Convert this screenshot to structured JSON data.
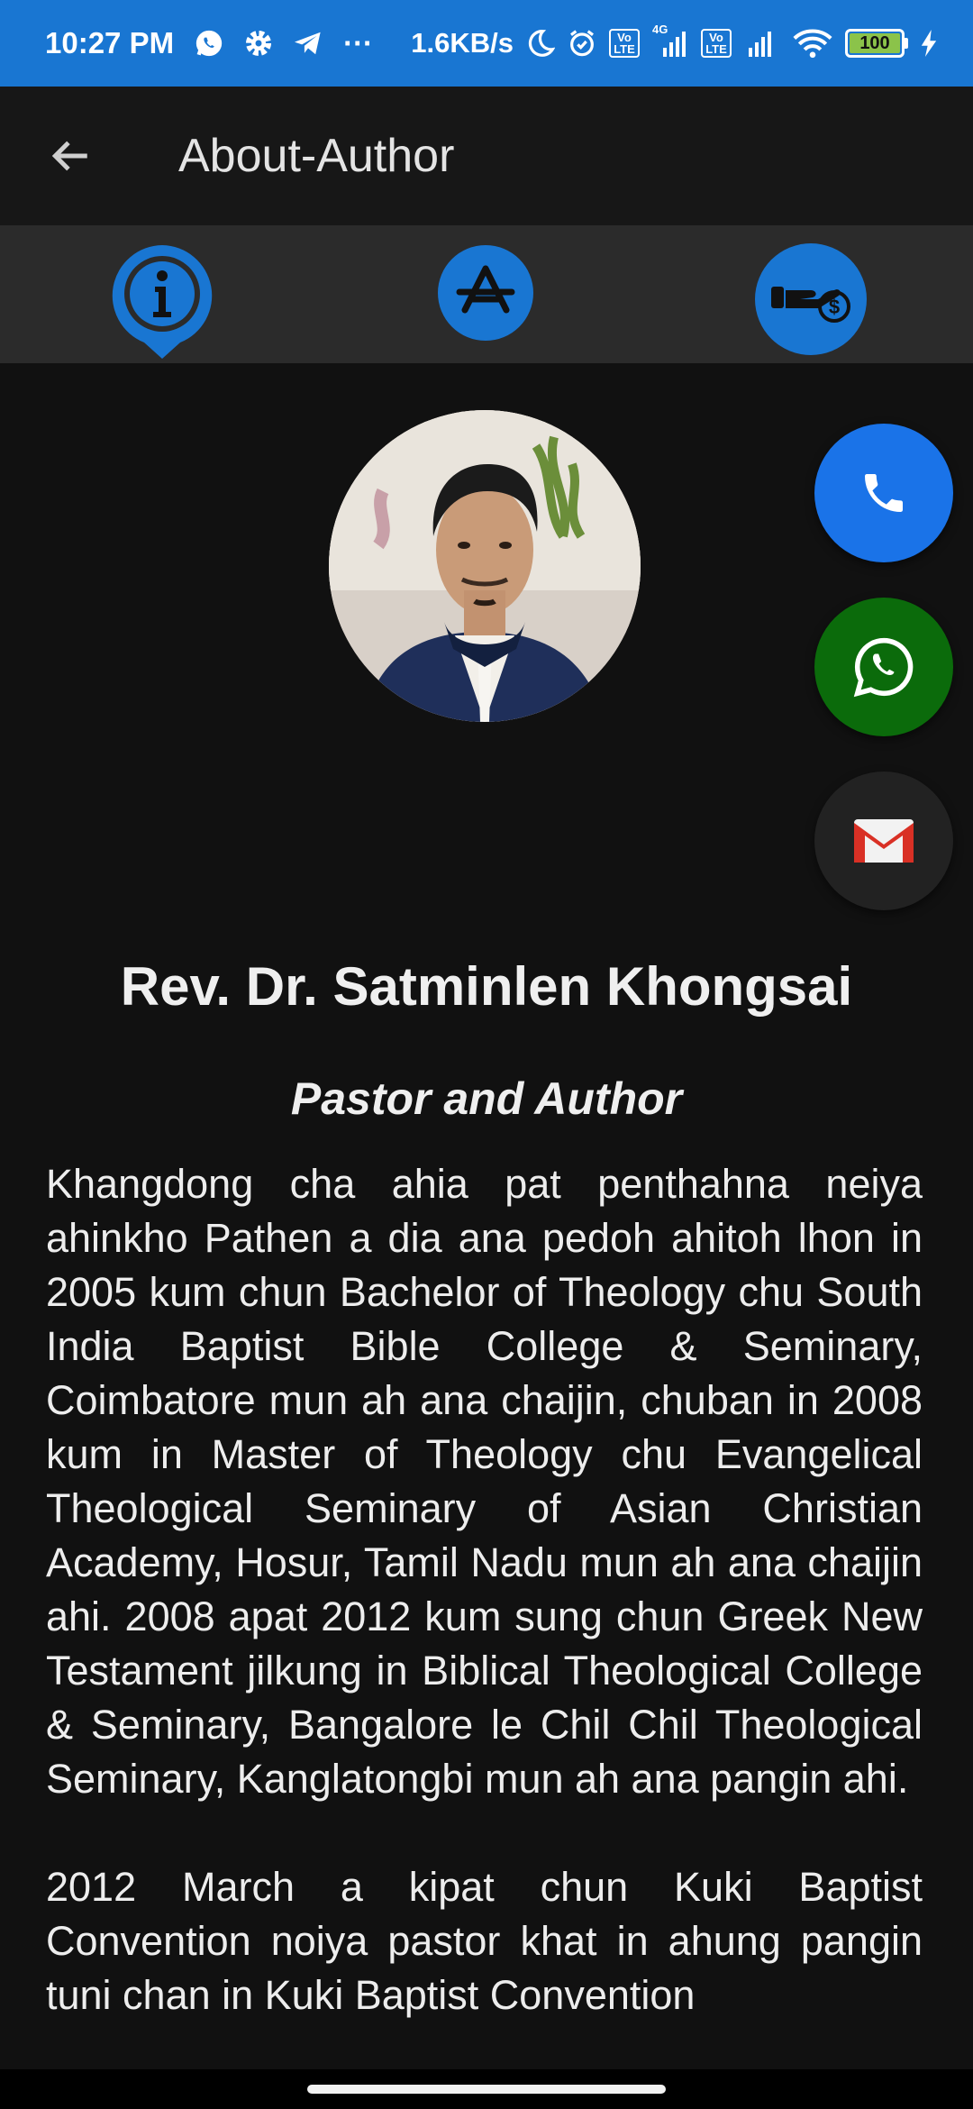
{
  "status_bar": {
    "time": "10:27 PM",
    "more": "···",
    "speed": "1.6KB/s",
    "net_badge_1": "Vo LTE",
    "net_badge_4g": "4G",
    "net_badge_2": "Vo LTE",
    "battery": "100",
    "icons": [
      "whatsapp-icon",
      "settings-icon",
      "telegram-icon",
      "moon-icon",
      "alarm-icon",
      "signal-icon",
      "wifi-icon",
      "battery-icon",
      "charging-icon"
    ]
  },
  "app_bar": {
    "title": "About-Author",
    "back_icon": "arrow-back-icon"
  },
  "tabs": [
    {
      "icon": "info-icon"
    },
    {
      "icon": "app-store-icon"
    },
    {
      "icon": "donate-icon"
    }
  ],
  "fabs": [
    {
      "icon": "phone-icon",
      "color": "#1a73e8"
    },
    {
      "icon": "whatsapp-icon",
      "color": "#0b6b0b"
    },
    {
      "icon": "gmail-icon",
      "color": "#222222"
    }
  ],
  "profile": {
    "name": "Rev. Dr. Satminlen Khongsai",
    "role": "Pastor and Author"
  },
  "bio": [
    "Khangdong cha ahia pat penthahna neiya ahinkho Pathen a dia ana pedoh ahitoh lhon in 2005 kum chun Bachelor of Theology chu South India Baptist Bible College & Seminary, Coimbatore mun ah ana chaijin, chuban in 2008 kum in  Master of Theology chu Evangelical Theological Seminary of Asian Christian Academy, Hosur, Tamil Nadu mun ah ana chaijin ahi. 2008 apat 2012 kum sung chun Greek New Testament jilkung in Biblical Theological College & Seminary, Bangalore le Chil Chil Theological Seminary, Kanglatongbi mun ah ana pangin ahi.",
    "2012 March a kipat chun Kuki Baptist Convention noiya pastor khat in ahung pangin tuni chan in Kuki Baptist Convention"
  ],
  "colors": {
    "status_bar": "#1976d2",
    "accent_blue": "#1976d2",
    "background": "#111111"
  }
}
